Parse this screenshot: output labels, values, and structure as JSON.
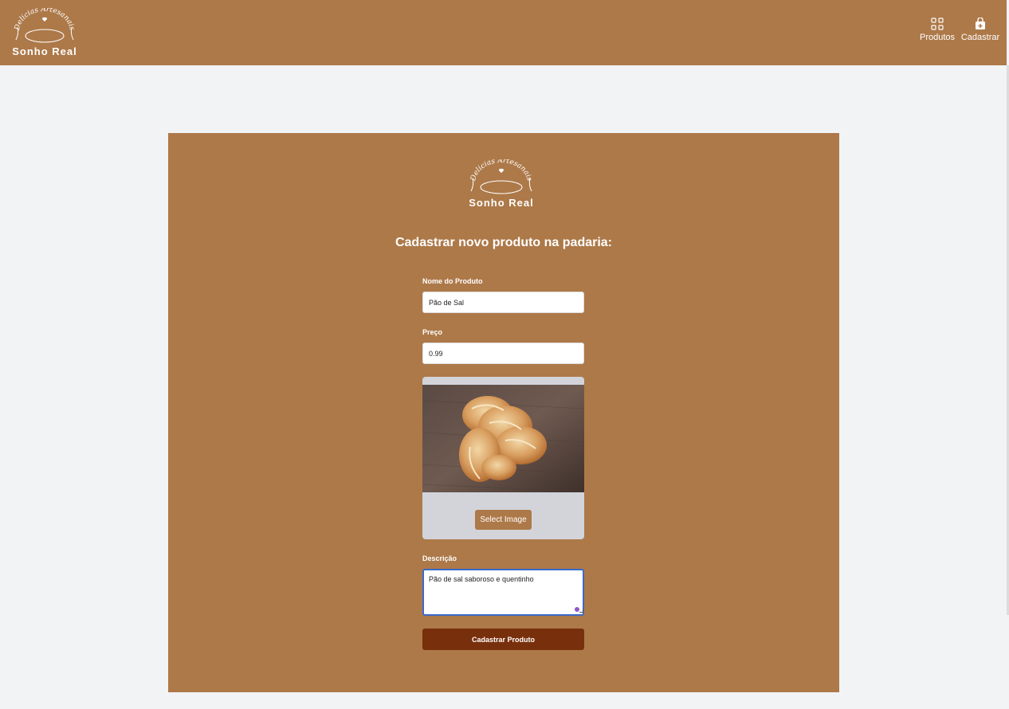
{
  "header": {
    "logo": {
      "arc_text": "Delicias Artesanais",
      "brand": "Sonho Real"
    },
    "nav": [
      {
        "label": "Produtos",
        "icon": "grid-icon"
      },
      {
        "label": "Cadastrar",
        "icon": "shopping-bag-plus-icon"
      }
    ]
  },
  "form": {
    "logo": {
      "arc_text": "Delicias Artesanais",
      "brand": "Sonho Real"
    },
    "title": "Cadastrar novo produto na padaria:",
    "nome": {
      "label": "Nome do Produto",
      "value": "Pão de Sal"
    },
    "preco": {
      "label": "Preço",
      "value": "0.99"
    },
    "image": {
      "button_label": "Select Image"
    },
    "descricao": {
      "label": "Descrição",
      "value": "Pão de sal saboroso e quentinho"
    },
    "submit_label": "Cadastrar Produto"
  },
  "colors": {
    "brand_brown": "#ad7949",
    "submit_dark": "#78300c",
    "page_bg": "#f2f3f5",
    "image_panel": "#d2d4da",
    "focus_border": "#3b69c9"
  }
}
